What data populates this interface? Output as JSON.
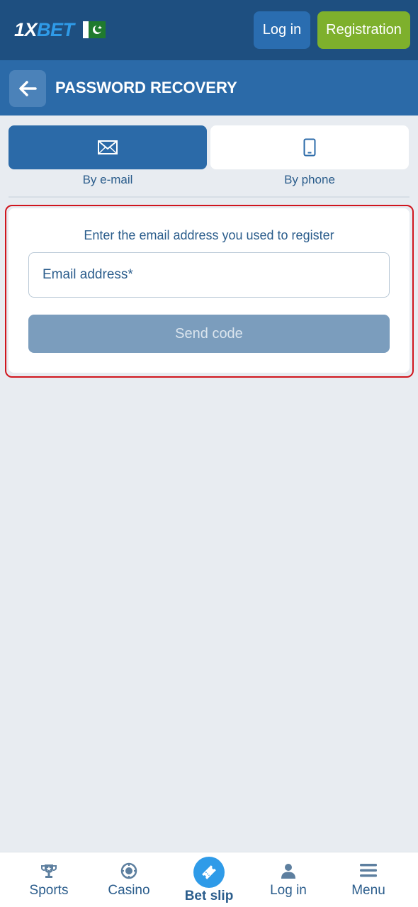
{
  "header": {
    "logo": "1XBET",
    "login_label": "Log in",
    "register_label": "Registration"
  },
  "subheader": {
    "title": "PASSWORD RECOVERY"
  },
  "tabs": [
    {
      "label": "By e-mail",
      "icon": "envelope-icon",
      "active": true
    },
    {
      "label": "By phone",
      "icon": "phone-icon",
      "active": false
    }
  ],
  "form": {
    "hint": "Enter the email address you used to register",
    "email_placeholder": "Email address*",
    "submit_label": "Send code"
  },
  "bottom_nav": [
    {
      "label": "Sports",
      "icon": "trophy-icon"
    },
    {
      "label": "Casino",
      "icon": "casino-chip-icon"
    },
    {
      "label": "Bet slip",
      "icon": "ticket-icon"
    },
    {
      "label": "Log in",
      "icon": "user-icon"
    },
    {
      "label": "Menu",
      "icon": "hamburger-icon"
    }
  ],
  "colors": {
    "header_bg": "#1e4f80",
    "subheader_bg": "#2b6aa8",
    "accent_green": "#7eb02c",
    "accent_blue": "#2f9be8",
    "highlight_red": "#d0161e"
  }
}
